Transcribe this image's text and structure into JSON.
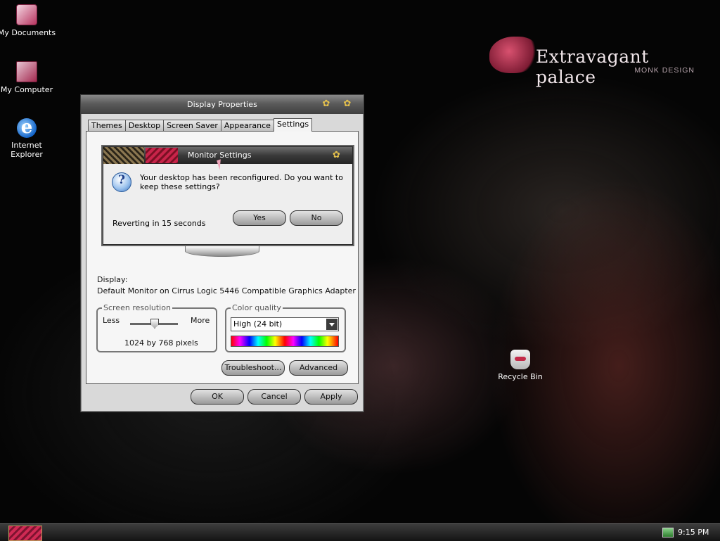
{
  "desktop": {
    "icons": [
      {
        "label": "My Documents"
      },
      {
        "label": "My Computer"
      },
      {
        "label": "Internet Explorer"
      },
      {
        "label": "Recycle Bin"
      }
    ],
    "brand": {
      "title": "Extravagant palace",
      "subtitle": "MONK DESIGN"
    }
  },
  "display_properties": {
    "title": "Display Properties",
    "tabs": [
      "Themes",
      "Desktop",
      "Screen Saver",
      "Appearance",
      "Settings"
    ],
    "active_tab": "Settings",
    "display_label": "Display:",
    "display_value": "Default Monitor on Cirrus Logic 5446 Compatible Graphics Adapter",
    "screen_resolution": {
      "title": "Screen resolution",
      "less": "Less",
      "more": "More",
      "value": "1024 by 768 pixels",
      "slider_fraction": 0.5
    },
    "color_quality": {
      "title": "Color quality",
      "selected": "High (24 bit)"
    },
    "buttons": {
      "troubleshoot": "Troubleshoot...",
      "advanced": "Advanced",
      "ok": "OK",
      "cancel": "Cancel",
      "apply": "Apply"
    }
  },
  "monitor_settings": {
    "title": "Monitor Settings",
    "message": "Your desktop has been reconfigured.  Do you want to keep these settings?",
    "reverting": "Reverting in 15 seconds",
    "yes": "Yes",
    "no": "No",
    "icon": "question-icon"
  },
  "taskbar": {
    "clock": "9:15 PM"
  },
  "colors": {
    "accent": "#c8244a",
    "gold": "#e7c24c"
  }
}
